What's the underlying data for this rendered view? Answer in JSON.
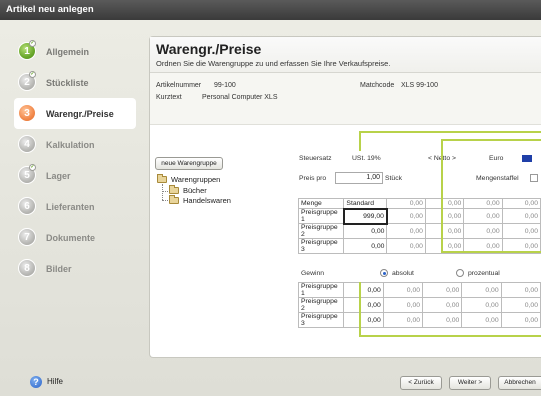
{
  "window": {
    "title": "Artikel neu anlegen"
  },
  "steps": [
    {
      "num": "1",
      "label": "Allgemein"
    },
    {
      "num": "2",
      "label": "Stückliste"
    },
    {
      "num": "3",
      "label": "Warengr./Preise"
    },
    {
      "num": "4",
      "label": "Kalkulation"
    },
    {
      "num": "5",
      "label": "Lager"
    },
    {
      "num": "6",
      "label": "Lieferanten"
    },
    {
      "num": "7",
      "label": "Dokumente"
    },
    {
      "num": "8",
      "label": "Bilder"
    }
  ],
  "panel": {
    "title": "Warengr./Preise",
    "subtitle": "Ordnen Sie die Warengruppe zu und erfassen Sie Ihre Verkaufspreise."
  },
  "info": {
    "artnr_label": "Artikelnummer",
    "artnr_value": "99-100",
    "kurztext_label": "Kurztext",
    "kurztext_value": "Personal Computer XLS",
    "matchcode_label": "Matchcode",
    "matchcode_value": "XLS 99-100"
  },
  "tree": {
    "new_button": "neue Warengruppe",
    "root": "Warengruppen",
    "children": [
      "Bücher",
      "Handelswaren"
    ]
  },
  "pricing": {
    "steuersatz_label": "Steuersatz",
    "steuersatz_value": "USt. 19%",
    "netto": "< Netto >",
    "currency": "Euro",
    "preis_pro_label": "Preis pro",
    "preis_pro_value": "1,00",
    "unit": "Stück",
    "mengenstaffel": "Mengenstaffel",
    "menge_header": "Menge",
    "standard_header": "Standard",
    "rows": [
      {
        "label": "Preisgruppe 1",
        "values": [
          "999,00",
          "0,00",
          "0,00",
          "0,00",
          "0,00"
        ]
      },
      {
        "label": "Preisgruppe 2",
        "values": [
          "0,00",
          "0,00",
          "0,00",
          "0,00",
          "0,00"
        ]
      },
      {
        "label": "Preisgruppe 3",
        "values": [
          "0,00",
          "0,00",
          "0,00",
          "0,00",
          "0,00"
        ]
      }
    ],
    "header_values": [
      "0,00",
      "0,00",
      "0,00",
      "0,00"
    ]
  },
  "gewinn": {
    "label": "Gewinn",
    "absolut": "absolut",
    "prozentual": "prozentual",
    "rows": [
      {
        "label": "Preisgruppe 1",
        "values": [
          "0,00",
          "0,00",
          "0,00",
          "0,00",
          "0,00"
        ]
      },
      {
        "label": "Preisgruppe 2",
        "values": [
          "0,00",
          "0,00",
          "0,00",
          "0,00",
          "0,00"
        ]
      },
      {
        "label": "Preisgruppe 3",
        "values": [
          "0,00",
          "0,00",
          "0,00",
          "0,00",
          "0,00"
        ]
      }
    ]
  },
  "footer": {
    "help": "Hilfe",
    "back": "< Zurück",
    "next": "Weiter >",
    "cancel": "Abbrechen"
  },
  "colors": {
    "accent_green": "#b8d24a",
    "active_step": "#f2884a"
  }
}
